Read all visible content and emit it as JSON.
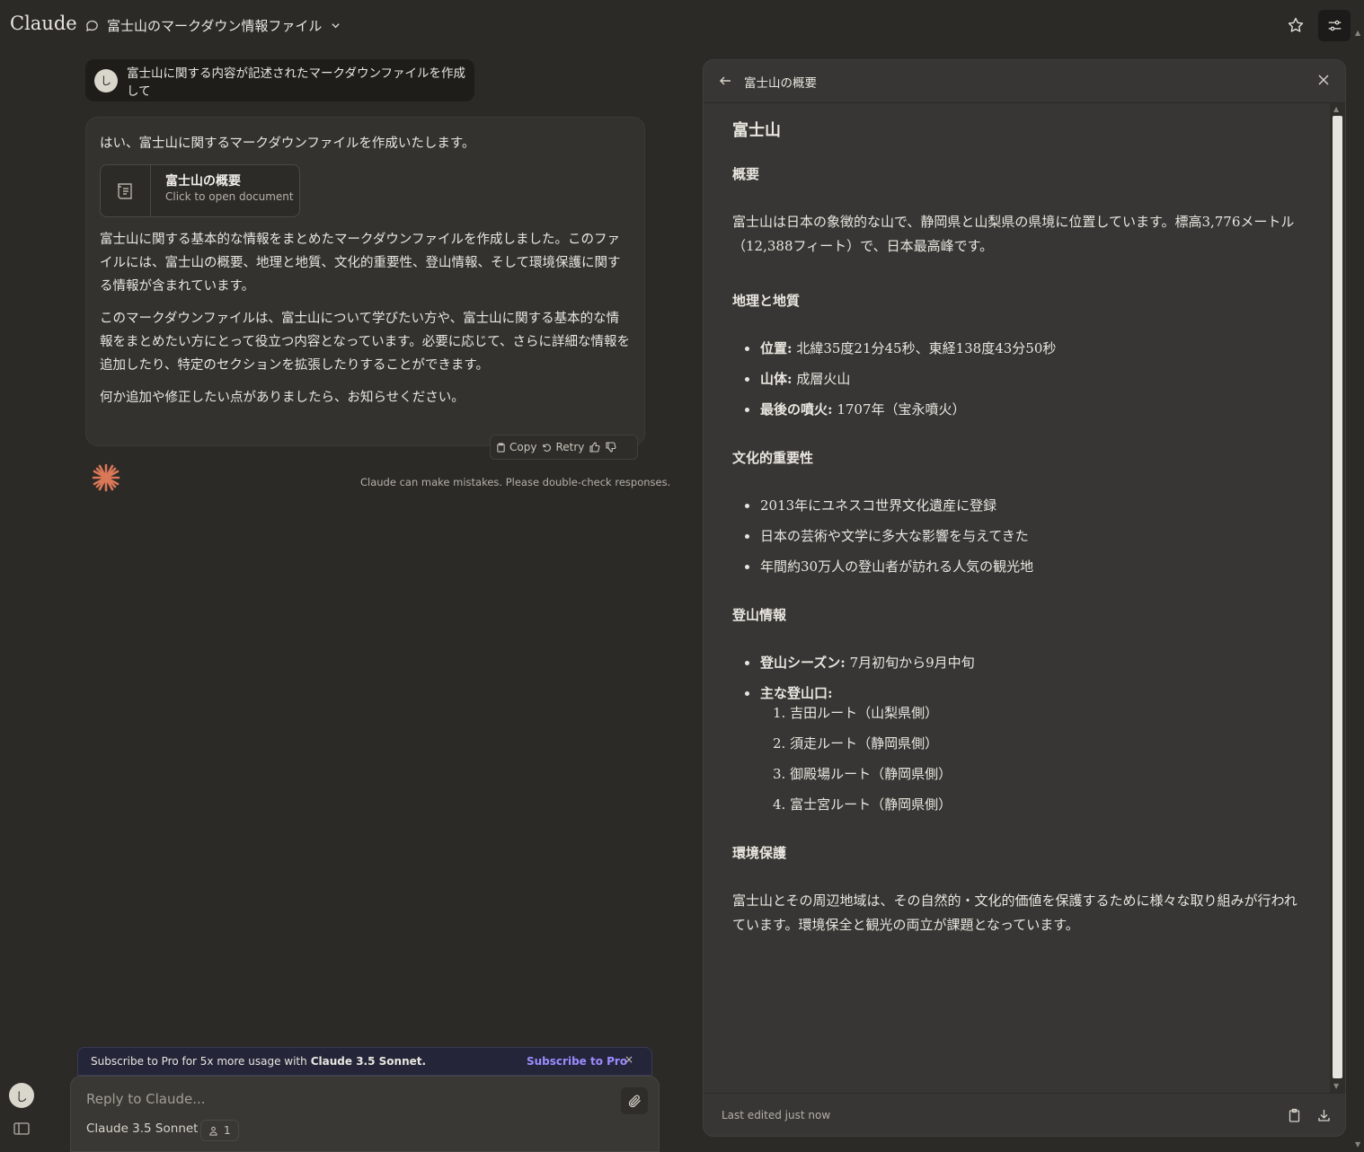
{
  "app": {
    "logo": "Claude"
  },
  "header": {
    "conversation_title": "富士山のマークダウン情報ファイル"
  },
  "user_message": {
    "avatar_initial": "し",
    "text": "富士山に関する内容が記述されたマークダウンファイルを作成して"
  },
  "assistant_message": {
    "intro": "はい、富士山に関するマークダウンファイルを作成いたします。",
    "artifact": {
      "title": "富士山の概要",
      "subtitle": "Click to open document"
    },
    "paragraphs": [
      "富士山に関する基本的な情報をまとめたマークダウンファイルを作成しました。このファイルには、富士山の概要、地理と地質、文化的重要性、登山情報、そして環境保護に関する情報が含まれています。",
      "このマークダウンファイルは、富士山について学びたい方や、富士山に関する基本的な情報をまとめたい方にとって役立つ内容となっています。必要に応じて、さらに詳細な情報を追加したり、特定のセクションを拡張したりすることができます。",
      "何か追加や修正したい点がありましたら、お知らせください。"
    ],
    "actions": {
      "copy": "Copy",
      "retry": "Retry"
    }
  },
  "disclaimer": "Claude can make mistakes. Please double-check responses.",
  "promo": {
    "text": "Subscribe to Pro for 5x more usage with",
    "model": "Claude 3.5 Sonnet.",
    "cta": "Subscribe to Pro",
    "close": "×"
  },
  "composer": {
    "placeholder": "Reply to Claude...",
    "model": "Claude 3.5 Sonnet",
    "count": "1"
  },
  "sidebar": {
    "avatar_initial": "し"
  },
  "artifact_panel": {
    "title": "富士山の概要",
    "doc": {
      "h1": "富士山",
      "sections": {
        "overview": {
          "heading": "概要",
          "text": "富士山は日本の象徴的な山で、静岡県と山梨県の県境に位置しています。標高3,776メートル（12,388フィート）で、日本最高峰です。"
        },
        "geo": {
          "heading": "地理と地質",
          "items": [
            {
              "label": "位置:",
              "value": " 北緯35度21分45秒、東経138度43分50秒"
            },
            {
              "label": "山体:",
              "value": " 成層火山"
            },
            {
              "label": "最後の噴火:",
              "value": " 1707年（宝永噴火）"
            }
          ]
        },
        "culture": {
          "heading": "文化的重要性",
          "items": [
            "2013年にユネスコ世界文化遺産に登録",
            "日本の芸術や文学に多大な影響を与えてきた",
            "年間約30万人の登山者が訪れる人気の観光地"
          ]
        },
        "climbing": {
          "heading": "登山情報",
          "season_label": "登山シーズン:",
          "season_value": " 7月初旬から9月中旬",
          "trails_label": "主な登山口:",
          "trails": [
            "1. 吉田ルート（山梨県側）",
            "2. 須走ルート（静岡県側）",
            "3. 御殿場ルート（静岡県側）",
            "4. 富士宮ルート（静岡県側）"
          ]
        },
        "env": {
          "heading": "環境保護",
          "text": "富士山とその周辺地域は、その自然的・文化的価値を保護するために様々な取り組みが行われています。環境保全と観光の両立が課題となっています。"
        }
      }
    },
    "footer": {
      "edited": "Last edited just now"
    }
  },
  "colors": {
    "background": "#2b2a27",
    "accent_link": "#9b8cff",
    "claude_spark": "#d97757"
  }
}
